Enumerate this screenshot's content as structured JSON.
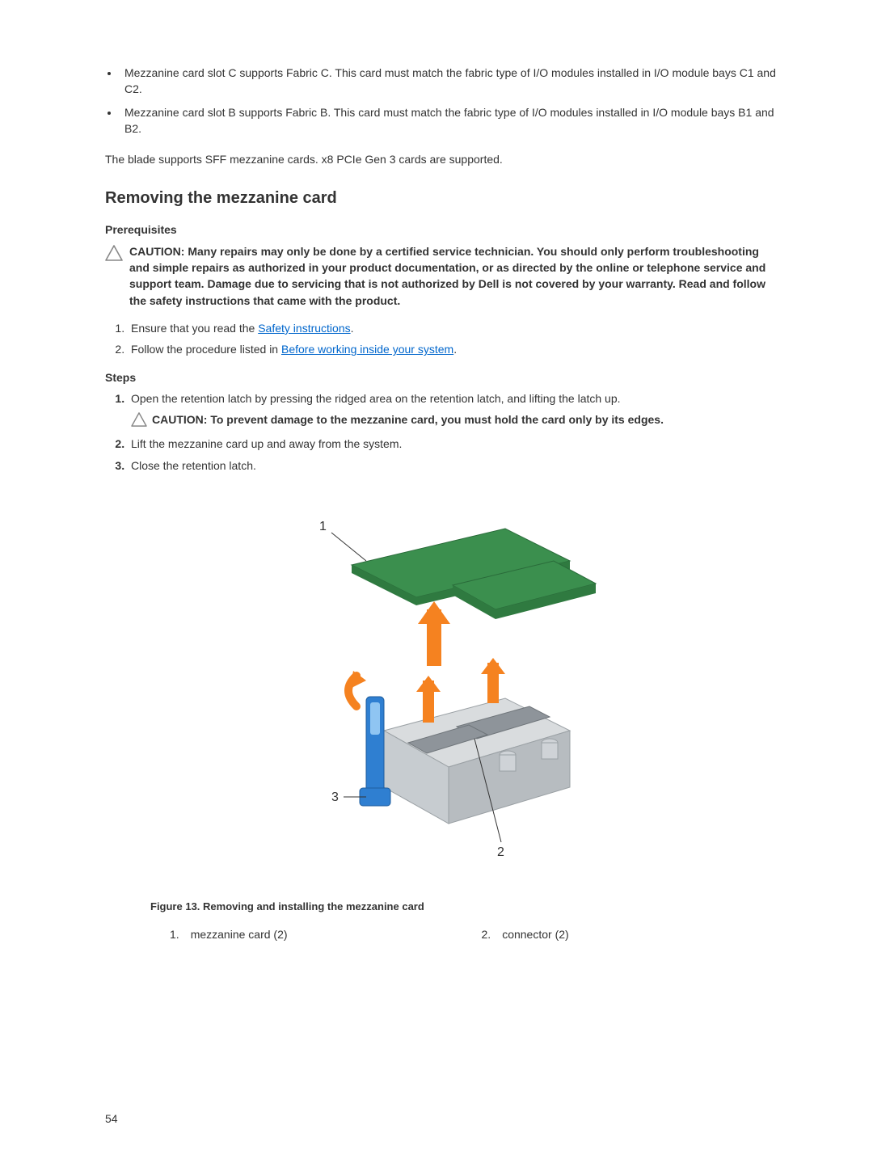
{
  "bullets": [
    "Mezzanine card slot C supports Fabric C. This card must match the fabric type of I/O modules installed in I/O module bays C1 and C2.",
    "Mezzanine card slot B supports Fabric B. This card must match the fabric type of I/O modules installed in I/O module bays B1 and B2."
  ],
  "intro_para": "The blade supports SFF mezzanine cards. x8 PCIe Gen 3 cards are supported.",
  "heading": "Removing the mezzanine card",
  "prereq_label": "Prerequisites",
  "caution1": "CAUTION: Many repairs may only be done by a certified service technician. You should only perform troubleshooting and simple repairs as authorized in your product documentation, or as directed by the online or telephone service and support team. Damage due to servicing that is not authorized by Dell is not covered by your warranty. Read and follow the safety instructions that came with the product.",
  "prereq_items": {
    "p1_pre": "Ensure that you read the ",
    "p1_link": "Safety instructions",
    "p1_post": ".",
    "p2_pre": "Follow the procedure listed in ",
    "p2_link": "Before working inside your system",
    "p2_post": "."
  },
  "steps_label": "Steps",
  "steps": {
    "s1": "Open the retention latch by pressing the ridged area on the retention latch, and lifting the latch up.",
    "caution2": "CAUTION: To prevent damage to the mezzanine card, you must hold the card only by its edges.",
    "s2": "Lift the mezzanine card up and away from the system.",
    "s3": "Close the retention latch."
  },
  "figure_caption": "Figure 13. Removing and installing the mezzanine card",
  "legend": {
    "n1": "1.",
    "l1": "mezzanine card (2)",
    "n2": "2.",
    "l2": "connector (2)"
  },
  "page_number": "54",
  "callouts": {
    "c1": "1",
    "c2": "2",
    "c3": "3"
  }
}
